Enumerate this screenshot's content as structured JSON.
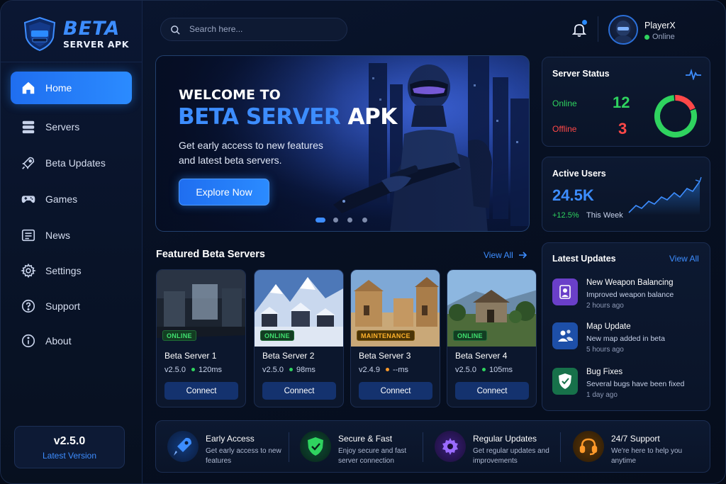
{
  "brand": {
    "title": "BETA",
    "subtitle": "SERVER APK"
  },
  "sidebar": {
    "items": [
      {
        "label": "Home",
        "icon": "home-icon",
        "active": true
      },
      {
        "label": "Servers",
        "icon": "servers-icon"
      },
      {
        "label": "Beta Updates",
        "icon": "rocket-icon"
      },
      {
        "label": "Games",
        "icon": "gamepad-icon"
      },
      {
        "label": "News",
        "icon": "news-icon"
      },
      {
        "label": "Settings",
        "icon": "gear-icon"
      },
      {
        "label": "Support",
        "icon": "question-icon"
      },
      {
        "label": "About",
        "icon": "info-icon"
      }
    ],
    "version": {
      "number": "v2.5.0",
      "label": "Latest Version"
    }
  },
  "topbar": {
    "search_placeholder": "Search here...",
    "user": {
      "name": "PlayerX",
      "status": "Online"
    }
  },
  "hero": {
    "welcome": "WELCOME TO",
    "title_accent": "BETA SERVER",
    "title_rest": "APK",
    "description": "Get early access to new features and latest beta servers.",
    "button": "Explore Now",
    "slides": 4,
    "active_slide": 1
  },
  "server_status": {
    "title": "Server Status",
    "online_label": "Online",
    "online_count": "12",
    "offline_label": "Offline",
    "offline_count": "3",
    "colors": {
      "online": "#2fd35f",
      "offline": "#ff4848"
    }
  },
  "active_users": {
    "title": "Active Users",
    "value": "24.5K",
    "change": "+12.5%",
    "period": "This Week"
  },
  "latest_updates": {
    "title": "Latest Updates",
    "view_all": "View All",
    "items": [
      {
        "title": "New Weapon Balancing",
        "desc": "Improved weapon balance",
        "time": "2 hours ago",
        "icon": "user-badge-icon",
        "color": "#6a3fc9"
      },
      {
        "title": "Map Update",
        "desc": "New map added in beta",
        "time": "5 hours ago",
        "icon": "users-icon",
        "color": "#1d4fa8"
      },
      {
        "title": "Bug Fixes",
        "desc": "Several bugs have been fixed",
        "time": "1 day ago",
        "icon": "shield-check-icon",
        "color": "#17714a"
      }
    ]
  },
  "featured": {
    "title": "Featured Beta Servers",
    "view_all": "View All",
    "servers": [
      {
        "name": "Beta Server 1",
        "version": "v2.5.0",
        "ping": "120ms",
        "status": "ONLINE",
        "connect": "Connect"
      },
      {
        "name": "Beta Server 2",
        "version": "v2.5.0",
        "ping": "98ms",
        "status": "ONLINE",
        "connect": "Connect"
      },
      {
        "name": "Beta Server 3",
        "version": "v2.4.9",
        "ping": "--ms",
        "status": "MAINTENANCE",
        "connect": "Connect"
      },
      {
        "name": "Beta Server 4",
        "version": "v2.5.0",
        "ping": "105ms",
        "status": "ONLINE",
        "connect": "Connect"
      }
    ]
  },
  "features": [
    {
      "title": "Early Access",
      "desc": "Get early access to new features",
      "icon": "rocket-icon"
    },
    {
      "title": "Secure & Fast",
      "desc": "Enjoy secure and fast server connection",
      "icon": "shield-check-icon"
    },
    {
      "title": "Regular Updates",
      "desc": "Get regular updates and improvements",
      "icon": "gear-icon"
    },
    {
      "title": "24/7 Support",
      "desc": "We're here to help you anytime",
      "icon": "headset-icon"
    }
  ]
}
